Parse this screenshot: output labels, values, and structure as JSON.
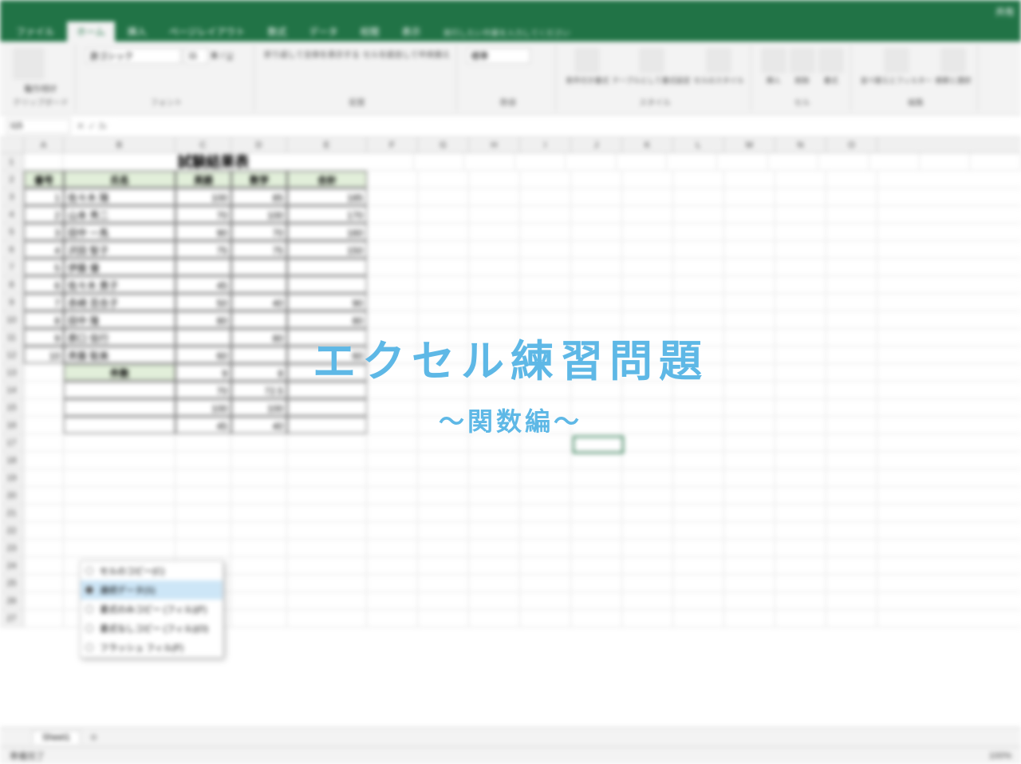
{
  "titlebar": {
    "share": "共有"
  },
  "tabs": {
    "file": "ファイル",
    "home": "ホーム",
    "insert": "挿入",
    "layout": "ページレイアウト",
    "formulas": "数式",
    "data": "データ",
    "review": "校閲",
    "view": "表示",
    "tell_me": "実行したい作業を入力してください"
  },
  "ribbon": {
    "clipboard": "クリップボード",
    "paste": "貼り付け",
    "font_group": "フォント",
    "font_name": "游ゴシック",
    "font_size": "11",
    "alignment": "配置",
    "wrap": "折り返して全体を表示する",
    "merge": "セルを結合して中央揃え",
    "number": "数値",
    "number_format": "標準",
    "styles": "スタイル",
    "cond_format": "条件付き書式",
    "table_format": "テーブルとして書式設定",
    "cell_styles": "セルのスタイル",
    "cells": "セル",
    "insert_btn": "挿入",
    "delete_btn": "削除",
    "format_btn": "書式",
    "editing": "編集",
    "sort": "並べ替えとフィルター",
    "find": "検索と選択"
  },
  "namebox": "I15",
  "columns": [
    "A",
    "B",
    "C",
    "D",
    "E",
    "F",
    "G",
    "H",
    "I",
    "J",
    "K",
    "L",
    "M",
    "N",
    "O"
  ],
  "table_title": "試験結果表",
  "headers": {
    "no": "番号",
    "name": "氏名",
    "eng": "英語",
    "math": "数学",
    "total": "合計"
  },
  "rows": [
    {
      "no": "1",
      "name": "佐々木 陽",
      "eng": "100",
      "math": "85",
      "total": "185"
    },
    {
      "no": "2",
      "name": "山本 秀二",
      "eng": "70",
      "math": "100",
      "total": "170"
    },
    {
      "no": "3",
      "name": "田中 一馬",
      "eng": "90",
      "math": "70",
      "total": "160"
    },
    {
      "no": "4",
      "name": "沢田 智子",
      "eng": "75",
      "math": "75",
      "total": "150"
    },
    {
      "no": "5",
      "name": "伊藤 優",
      "eng": "",
      "math": "",
      "total": ""
    },
    {
      "no": "6",
      "name": "佐々木 貴子",
      "eng": "45",
      "math": "",
      "total": ""
    },
    {
      "no": "7",
      "name": "赤崎 百合子",
      "eng": "50",
      "math": "40",
      "total": "90"
    },
    {
      "no": "8",
      "name": "田中 隆",
      "eng": "80",
      "math": "",
      "total": "80"
    },
    {
      "no": "9",
      "name": "原口 信行",
      "eng": "",
      "math": "80",
      "total": ""
    },
    {
      "no": "10",
      "name": "斉藤 聡美",
      "eng": "60",
      "math": "",
      "total": "60"
    }
  ],
  "summary": [
    {
      "label": "件数",
      "c": "9",
      "d": "8",
      "e": ""
    },
    {
      "label": "",
      "c": "70",
      "d": "72.5",
      "e": ""
    },
    {
      "label": "",
      "c": "100",
      "d": "100",
      "e": ""
    },
    {
      "label": "",
      "c": "45",
      "d": "40",
      "e": ""
    }
  ],
  "ctx": {
    "copy_cells": "セルのコピー(C)",
    "fill_series": "連続データ(S)",
    "fill_fmt": "書式のみコピー (フィル)(F)",
    "fill_no_fmt": "書式なしコピー (フィル)(O)",
    "flash_fill": "フラッシュ フィル(F)"
  },
  "sheet": "Sheet1",
  "status": "準備完了",
  "zoom": "100%",
  "overlay": {
    "title": "エクセル練習問題",
    "sub": "～関数編～"
  }
}
